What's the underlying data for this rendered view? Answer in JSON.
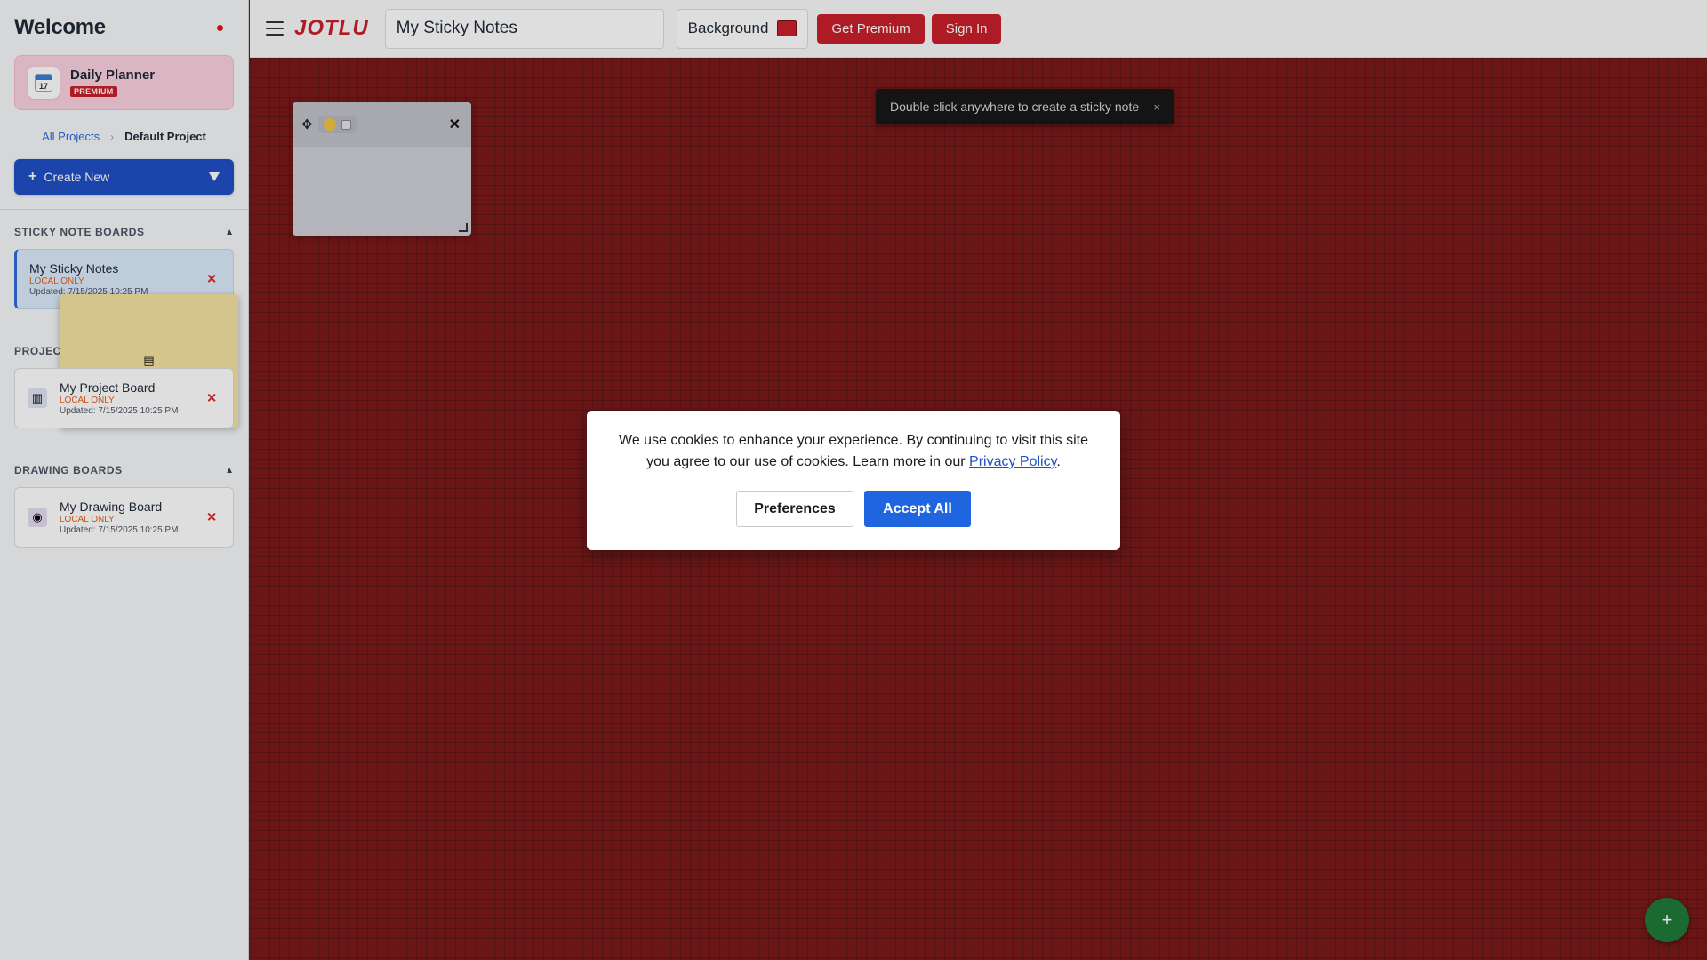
{
  "sidebar": {
    "title": "Welcome",
    "planner": {
      "title": "Daily Planner",
      "badge": "PREMIUM",
      "calendar_day": "17"
    },
    "breadcrumb": {
      "root": "All Projects",
      "separator": "›",
      "current": "Default Project"
    },
    "create_button": {
      "plus": "+",
      "label": "Create New"
    },
    "sections": [
      {
        "title": "STICKY NOTE BOARDS",
        "boards": [
          {
            "name": "My Sticky Notes",
            "status": "LOCAL ONLY",
            "updated": "Updated: 7/15/2025 10:25 PM",
            "icon": "notepad-icon"
          }
        ]
      },
      {
        "title": "PROJECT BOARDS",
        "boards": [
          {
            "name": "My Project Board",
            "status": "LOCAL ONLY",
            "updated": "Updated: 7/15/2025 10:25 PM",
            "icon": "chart-icon"
          }
        ]
      },
      {
        "title": "DRAWING BOARDS",
        "boards": [
          {
            "name": "My Drawing Board",
            "status": "LOCAL ONLY",
            "updated": "Updated: 7/15/2025 10:25 PM",
            "icon": "palette-icon"
          }
        ]
      }
    ],
    "collapse_glyph": "▲",
    "delete_glyph": "✕"
  },
  "topbar": {
    "logo": "JOTLU",
    "board_title": "My Sticky Notes",
    "background_label": "Background",
    "background_color": "#c8202a",
    "premium_button": "Get Premium",
    "signin_button": "Sign In"
  },
  "canvas": {
    "background_color": "#7a1a1a",
    "note": {
      "move_glyph": "✥",
      "close_glyph": "✕"
    },
    "toast": {
      "text": "Double click anywhere to create a sticky note",
      "close_glyph": "×"
    },
    "fab_glyph": "+"
  },
  "cookie": {
    "text": "We use cookies to enhance your experience. By continuing to visit this site you agree to our use of cookies. Learn more in our ",
    "link": "Privacy Policy",
    "end": ".",
    "preferences": "Preferences",
    "accept": "Accept All"
  },
  "colors": {
    "accent_red": "#c8202a",
    "primary_blue": "#1f50c4",
    "accept_blue": "#1f65e0",
    "fab_green": "#1f7a3a"
  }
}
